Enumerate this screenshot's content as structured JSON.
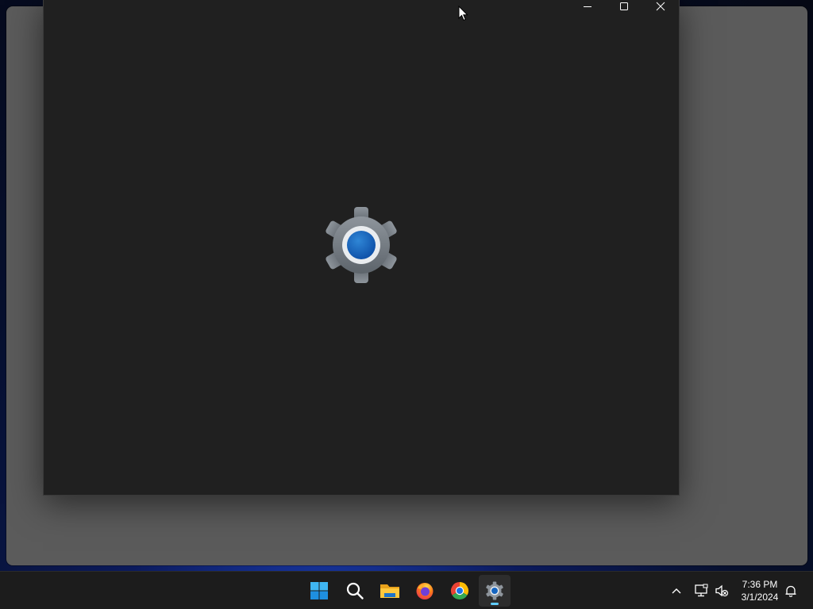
{
  "settings_window": {
    "controls": {
      "minimize": "minimize",
      "maximize": "maximize",
      "close": "close"
    },
    "splash_icon": "settings-gear-icon"
  },
  "taskbar": {
    "apps": [
      {
        "name": "Start",
        "icon": "windows-start-icon",
        "active": false
      },
      {
        "name": "Search",
        "icon": "search-icon",
        "active": false
      },
      {
        "name": "File Explorer",
        "icon": "folder-icon",
        "active": false
      },
      {
        "name": "Firefox",
        "icon": "firefox-icon",
        "active": false
      },
      {
        "name": "Chrome",
        "icon": "chrome-icon",
        "active": false
      },
      {
        "name": "Settings",
        "icon": "settings-gear-icon",
        "active": true
      }
    ],
    "tray": {
      "icons": [
        "chevron-up-icon",
        "network-icon",
        "speaker-muted-icon"
      ],
      "time": "7:36 PM",
      "date": "3/1/2024",
      "notification_icon": "bell-icon"
    }
  },
  "colors": {
    "window_bg": "#202020",
    "taskbar_bg": "#1c1c1c",
    "accent": "#60cdff",
    "gear_blue": "#1565c0"
  }
}
